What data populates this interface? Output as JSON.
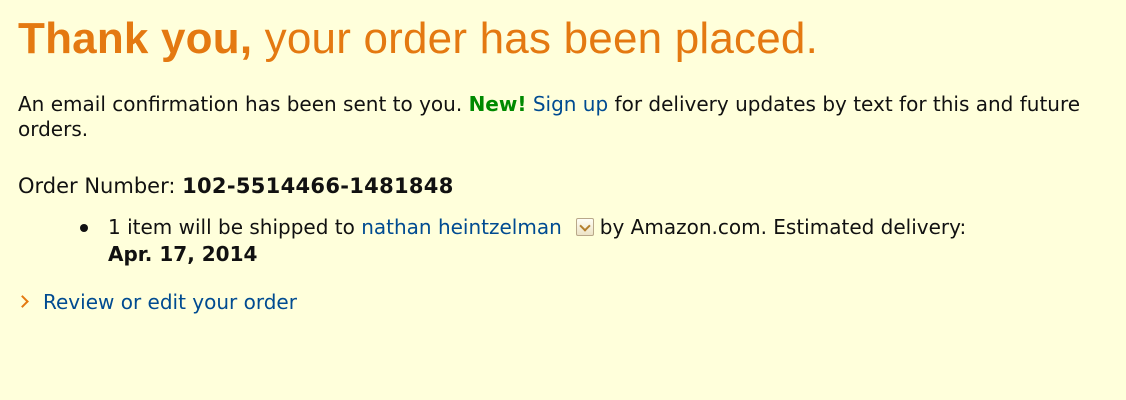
{
  "headline": {
    "strong": "Thank you,",
    "rest": " your order has been placed."
  },
  "confirmation": {
    "text_before": "An email confirmation has been sent to you. ",
    "new_badge": "New!",
    "signup_link": "Sign up",
    "text_after": " for delivery updates by text for this and future orders."
  },
  "order": {
    "label": "Order Number: ",
    "number": "102-5514466-1481848"
  },
  "shipment": {
    "text_before": "1 item will be shipped to ",
    "recipient": "nathan heintzelman",
    "dropdown_icon": "chevron-down-icon",
    "text_after": "by Amazon.com. Estimated delivery:",
    "delivery_date": "Apr. 17, 2014"
  },
  "review_link": "Review or edit your order",
  "colors": {
    "background": "#ffffdb",
    "headline": "#e47911",
    "new_badge": "#008a00",
    "link": "#004b91"
  }
}
